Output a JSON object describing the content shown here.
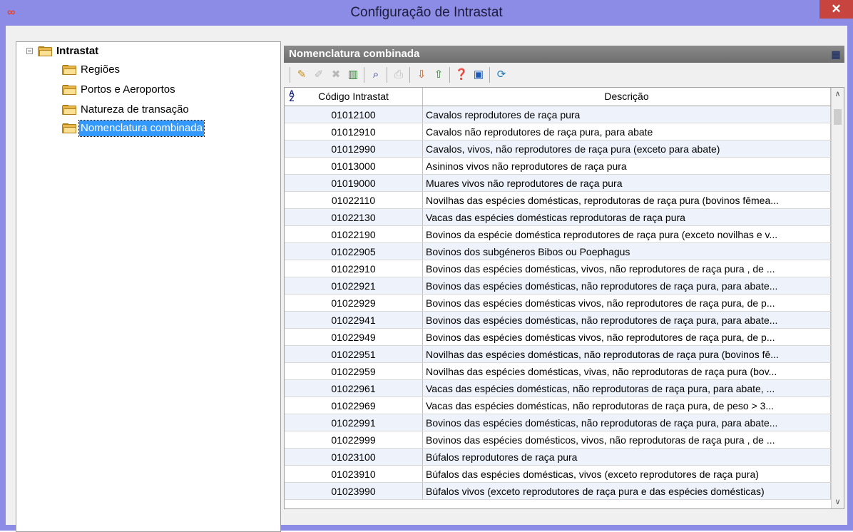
{
  "window": {
    "title": "Configuração de Intrastat",
    "app_icon": "∞",
    "close": "✕"
  },
  "tree": {
    "root": "Intrastat",
    "items": [
      {
        "label": "Regiões"
      },
      {
        "label": "Portos e Aeroportos"
      },
      {
        "label": "Natureza de transação"
      },
      {
        "label": "Nomenclatura combinada",
        "selected": true
      }
    ]
  },
  "panel": {
    "title": "Nomenclatura combinada",
    "corner_icon": "grid-settings-icon"
  },
  "toolbar": {
    "buttons": [
      "new-icon",
      "edit-icon",
      "delete-icon",
      "chart-icon",
      "find-icon",
      "print-icon",
      "import-icon",
      "export-icon",
      "help-icon",
      "save-icon",
      "refresh-icon"
    ]
  },
  "grid": {
    "columns": {
      "code": "Código Intrastat",
      "desc": "Descrição"
    },
    "rows": [
      {
        "code": "01012100",
        "desc": "Cavalos reprodutores de raça pura"
      },
      {
        "code": "01012910",
        "desc": "Cavalos não reprodutores de raça pura, para abate"
      },
      {
        "code": "01012990",
        "desc": "Cavalos, vivos, não reprodutores de raça pura (exceto para abate)"
      },
      {
        "code": "01013000",
        "desc": "Asininos vivos não reprodutores de raça pura"
      },
      {
        "code": "01019000",
        "desc": "Muares vivos não reprodutores de raça pura"
      },
      {
        "code": "01022110",
        "desc": "Novilhas das espécies domésticas, reprodutoras de raça pura (bovinos fêmea..."
      },
      {
        "code": "01022130",
        "desc": "Vacas das espécies domésticas reprodutoras de raça pura"
      },
      {
        "code": "01022190",
        "desc": "Bovinos da espécie doméstica reprodutores de raça pura (exceto novilhas e v..."
      },
      {
        "code": "01022905",
        "desc": "Bovinos dos subgéneros Bibos ou Poephagus"
      },
      {
        "code": "01022910",
        "desc": "Bovinos das espécies domésticas, vivos, não reprodutores de raça pura , de ..."
      },
      {
        "code": "01022921",
        "desc": "Bovinos das espécies domésticas, não reprodutores de raça pura, para abate..."
      },
      {
        "code": "01022929",
        "desc": "Bovinos das espécies domésticas vivos, não reprodutores de raça pura, de p..."
      },
      {
        "code": "01022941",
        "desc": "Bovinos das espécies domésticas, não reprodutores de raça pura, para abate..."
      },
      {
        "code": "01022949",
        "desc": "Bovinos das espécies domésticas vivos, não reprodutores de raça pura, de p..."
      },
      {
        "code": "01022951",
        "desc": "Novilhas das espécies domésticas, não reprodutoras de raça pura (bovinos fê..."
      },
      {
        "code": "01022959",
        "desc": "Novilhas das espécies domésticas, vivas, não reprodutoras de raça pura (bov..."
      },
      {
        "code": "01022961",
        "desc": "Vacas das espécies domésticas, não reprodutoras de raça pura, para abate, ..."
      },
      {
        "code": "01022969",
        "desc": "Vacas das espécies domésticas, não reprodutoras de raça pura, de peso > 3..."
      },
      {
        "code": "01022991",
        "desc": "Bovinos das espécies domésticas, não reprodutoras de raça pura, para abate..."
      },
      {
        "code": "01022999",
        "desc": "Bovinos das espécies domésticos, vivos, não reprodutoras de raça pura , de ..."
      },
      {
        "code": "01023100",
        "desc": "Búfalos reprodutores de raça pura"
      },
      {
        "code": "01023910",
        "desc": "Búfalos das espécies domésticas, vivos (exceto reprodutores de raça pura)"
      },
      {
        "code": "01023990",
        "desc": "Búfalos vivos (exceto reprodutores de raça pura e das espécies domésticas)"
      }
    ]
  }
}
